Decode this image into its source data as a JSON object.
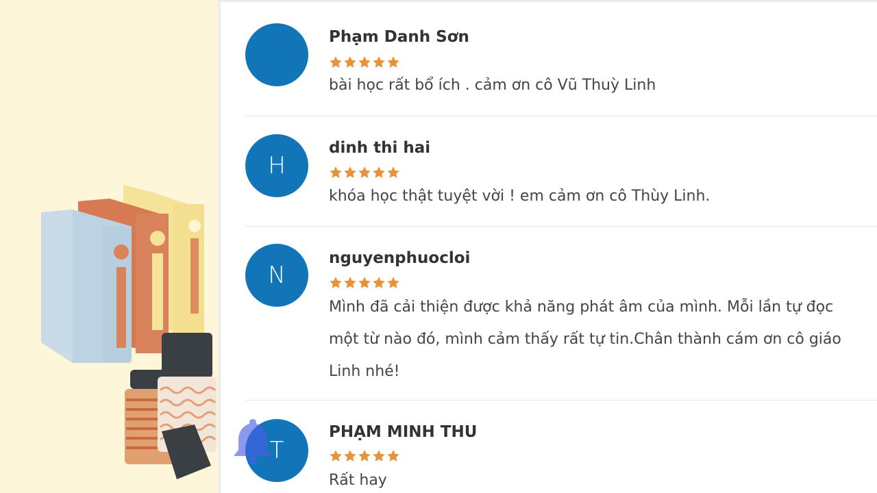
{
  "reviews": [
    {
      "author": "Phạm Danh Sơn",
      "avatar_initial": "",
      "rating": 5,
      "comment": "bài học rất bổ ích . cảm ơn cô Vũ Thuỳ Linh"
    },
    {
      "author": "dinh thi hai",
      "avatar_initial": "H",
      "rating": 5,
      "comment": "khóa học thật tuyệt vời ! em cảm ơn cô Thùy Linh."
    },
    {
      "author": "nguyenphuocloi",
      "avatar_initial": "N",
      "rating": 5,
      "comment": "Mình đã cải thiện được khả năng phát âm của mình. Mỗi lần tự đọc một từ nào đó, mình cảm thấy rất tự tin.Chân thành cám ơn cô giáo Linh nhé!"
    },
    {
      "author": "PHẠM MINH THU",
      "avatar_initial": "T",
      "rating": 5,
      "comment": "Rất hay"
    }
  ],
  "colors": {
    "background": "#fdf6d8",
    "avatar": "#1275b8",
    "star": "#e8923a",
    "bell": "#4a5ee8"
  },
  "icons": {
    "star": "star-icon",
    "bell": "bell-icon"
  }
}
